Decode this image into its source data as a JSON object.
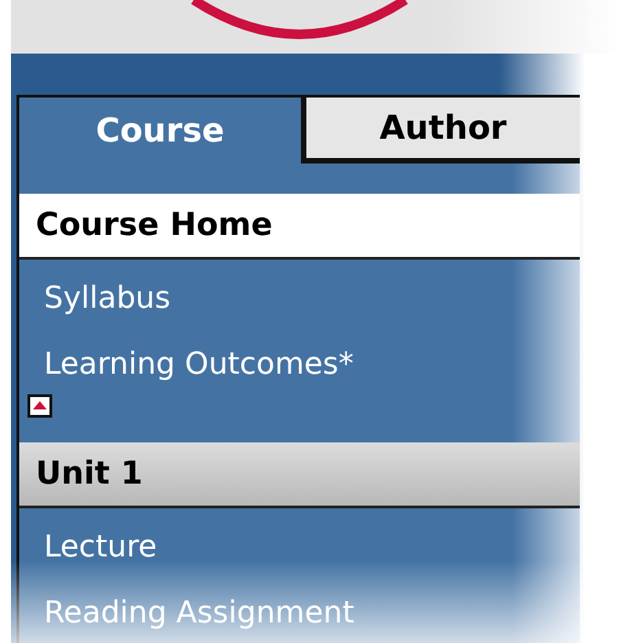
{
  "tabs": [
    {
      "label": "Course",
      "selected": true
    },
    {
      "label": "Author",
      "selected": false
    }
  ],
  "sections": [
    {
      "title": "Course Home",
      "selected": true,
      "items": [
        {
          "label": "Syllabus"
        },
        {
          "label": "Learning Outcomes*"
        }
      ],
      "collapse_control": true
    },
    {
      "title": "Unit 1",
      "selected": false,
      "items": [
        {
          "label": "Lecture"
        },
        {
          "label": "Reading Assignment"
        }
      ],
      "collapse_control": false
    }
  ]
}
